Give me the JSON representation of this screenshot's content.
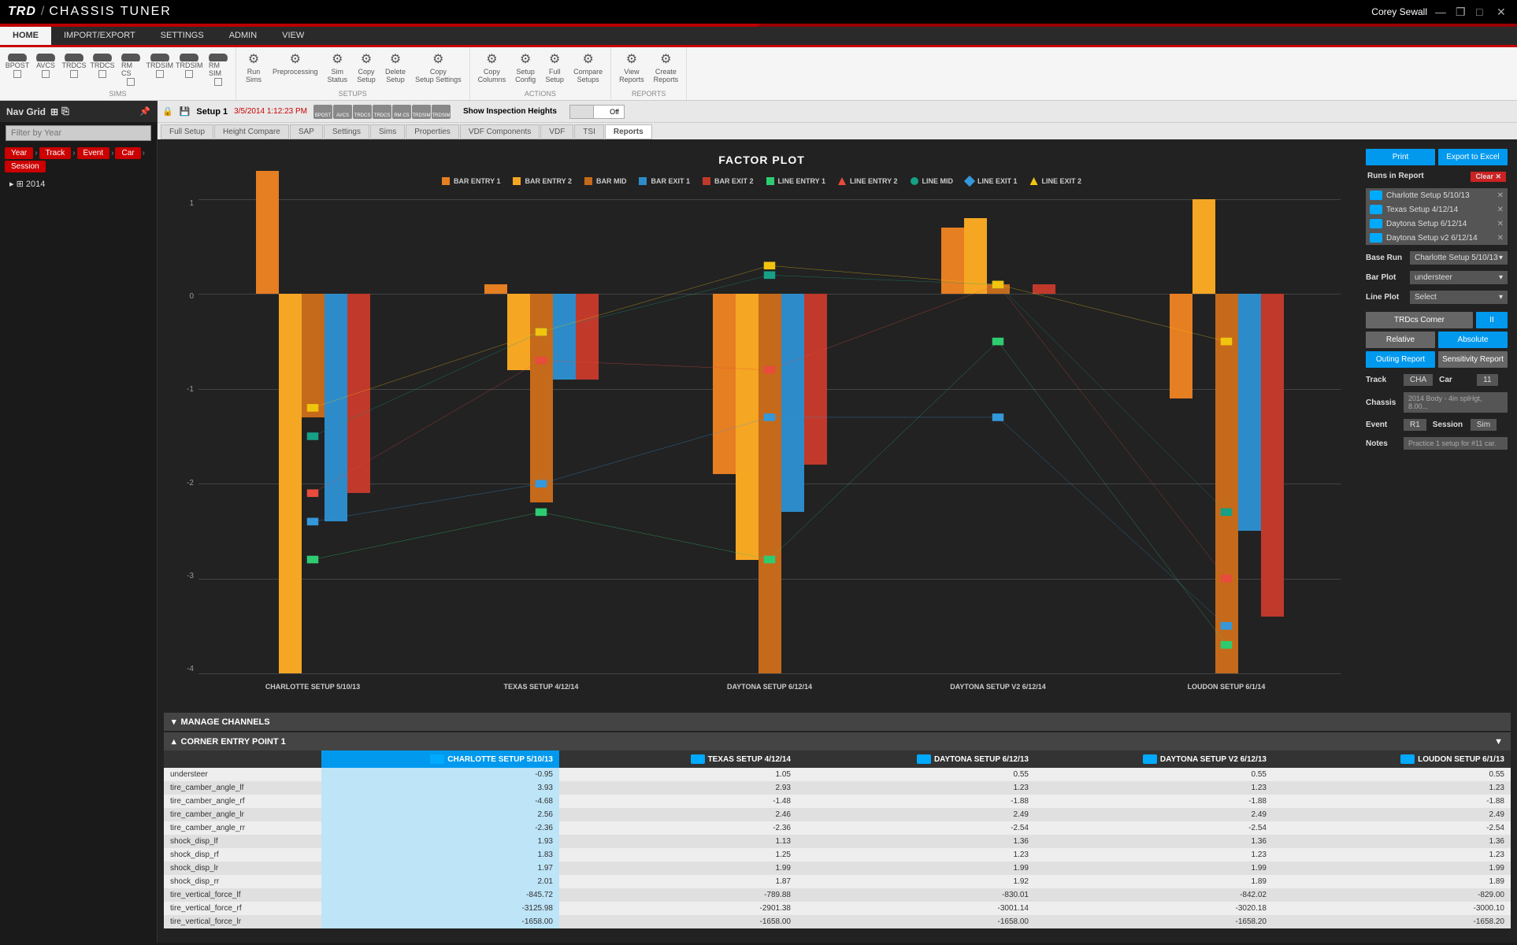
{
  "app": {
    "logo": "TRD",
    "sep": "/",
    "title": "CHASSIS TUNER",
    "user": "Corey Sewall"
  },
  "menu": [
    "HOME",
    "IMPORT/EXPORT",
    "SETTINGS",
    "ADMIN",
    "VIEW"
  ],
  "ribbon": {
    "sims": {
      "label": "SIMS",
      "items": [
        "BPOST",
        "AVCS",
        "TRDCS",
        "TRDCS",
        "RM CS",
        "TRDSIM",
        "TRDSIM",
        "RM SIM"
      ]
    },
    "actions_btns": [
      {
        "l1": "Run",
        "l2": "Sims"
      },
      {
        "l1": "Preprocessing",
        "l2": ""
      },
      {
        "l1": "Sim",
        "l2": "Status"
      },
      {
        "l1": "Copy",
        "l2": "Setup"
      },
      {
        "l1": "Delete",
        "l2": "Setup"
      },
      {
        "l1": "Copy",
        "l2": "Setup Settings"
      }
    ],
    "setups_label": "SETUPS",
    "actions2": [
      {
        "l1": "Copy",
        "l2": "Columns"
      },
      {
        "l1": "Setup",
        "l2": "Config"
      },
      {
        "l1": "Full",
        "l2": "Setup"
      },
      {
        "l1": "Compare",
        "l2": "Setups"
      }
    ],
    "actions_label": "ACTIONS",
    "reports": [
      {
        "l1": "View",
        "l2": "Reports"
      },
      {
        "l1": "Create",
        "l2": "Reports"
      }
    ],
    "reports_label": "REPORTS"
  },
  "sidebar": {
    "title": "Nav Grid",
    "filter_placeholder": "Filter by Year",
    "crumbs": [
      "Year",
      "Track",
      "Event",
      "Car",
      "Session"
    ],
    "tree": [
      "2014"
    ]
  },
  "setupbar": {
    "name": "Setup 1",
    "date": "3/5/2014 1:12:23 PM",
    "mini": [
      "BPOST",
      "AVCS",
      "TRDCS",
      "TRDCS",
      "RM CS",
      "TRDSIM",
      "TRDSIM"
    ],
    "insp": "Show Inspection Heights",
    "off": "Off"
  },
  "tabs": [
    "Full Setup",
    "Height Compare",
    "SAP",
    "Settings",
    "Sims",
    "Properties",
    "VDF Components",
    "VDF",
    "TSI",
    "Reports"
  ],
  "chart_data": {
    "type": "bar",
    "title": "FACTOR PLOT",
    "categories": [
      "CHARLOTTE SETUP 5/10/13",
      "TEXAS SETUP 4/12/14",
      "DAYTONA SETUP 6/12/14",
      "DAYTONA SETUP V2 6/12/14",
      "LOUDON SETUP 6/1/14"
    ],
    "ylim": [
      -4,
      1
    ],
    "yticks": [
      1,
      0,
      -1,
      -2,
      -3,
      -4
    ],
    "bar_series": [
      {
        "name": "BAR ENTRY 1",
        "color": "#e67e22",
        "values": [
          1.3,
          0.1,
          -1.9,
          0.7,
          -1.1
        ]
      },
      {
        "name": "BAR ENTRY 2",
        "color": "#f5a623",
        "values": [
          -4.0,
          -0.8,
          -2.8,
          0.8,
          1.0
        ]
      },
      {
        "name": "BAR MID",
        "color": "#c56a1a",
        "values": [
          -1.3,
          -2.2,
          -4.0,
          0.1,
          -4.0
        ]
      },
      {
        "name": "BAR EXIT 1",
        "color": "#2d8bc9",
        "values": [
          -2.4,
          -0.9,
          -2.3,
          0.0,
          -2.5
        ]
      },
      {
        "name": "BAR EXIT 2",
        "color": "#c0392b",
        "values": [
          -2.1,
          -0.9,
          -1.8,
          0.1,
          -3.4
        ]
      }
    ],
    "line_series": [
      {
        "name": "LINE ENTRY 1",
        "color": "#2ecc71",
        "shape": "sq",
        "values": [
          -2.8,
          -2.3,
          -2.8,
          -0.5,
          -3.7
        ]
      },
      {
        "name": "LINE ENTRY 2",
        "color": "#e74c3c",
        "shape": "tri",
        "values": [
          -2.1,
          -0.7,
          -0.8,
          0.1,
          -3.0
        ]
      },
      {
        "name": "LINE MID",
        "color": "#16a085",
        "shape": "circ",
        "values": [
          -1.5,
          -0.4,
          0.2,
          0.1,
          -2.3
        ]
      },
      {
        "name": "LINE EXIT 1",
        "color": "#3498db",
        "shape": "dia",
        "values": [
          -2.4,
          -2.0,
          -1.3,
          -1.3,
          -3.5
        ]
      },
      {
        "name": "LINE EXIT 2",
        "color": "#f1c40f",
        "shape": "tri",
        "values": [
          -1.2,
          -0.4,
          0.3,
          0.1,
          -0.5
        ]
      }
    ]
  },
  "controls": {
    "print": "Print",
    "export": "Export to Excel",
    "runs_hdr": "Runs in Report",
    "clear": "Clear",
    "runs": [
      "Charlotte Setup 5/10/13",
      "Texas Setup 4/12/14",
      "Daytona Setup 6/12/14",
      "Daytona Setup v2 6/12/14"
    ],
    "base_run_lbl": "Base Run",
    "base_run": "Charlotte Setup 5/10/13",
    "bar_plot_lbl": "Bar Plot",
    "bar_plot": "understeer",
    "line_plot_lbl": "Line Plot",
    "line_plot": "Select",
    "trd": "TRDcs Corner",
    "ii": "II",
    "relative": "Relative",
    "absolute": "Absolute",
    "outing": "Outing Report",
    "sensitivity": "Sensitivity Report",
    "track_lbl": "Track",
    "track": "CHA",
    "car_lbl": "Car",
    "car": "11",
    "chassis_lbl": "Chassis",
    "chassis": "2014 Body - 4in splHgt, 8.00...",
    "event_lbl": "Event",
    "event": "R1",
    "session_lbl": "Session",
    "session": "Sim",
    "notes_lbl": "Notes",
    "notes": "Practice 1 setup for #11 car."
  },
  "table": {
    "manage": "MANAGE CHANNELS",
    "section": "CORNER ENTRY POINT 1",
    "headers": [
      "",
      "CHARLOTTE SETUP 5/10/13",
      "TEXAS SETUP 4/12/14",
      "DAYTONA SETUP 6/12/13",
      "DAYTONA SETUP V2 6/12/13",
      "LOUDON SETUP 6/1/13"
    ],
    "rows": [
      {
        "n": "understeer",
        "v": [
          "-0.95",
          "1.05",
          "0.55",
          "0.55",
          "0.55"
        ]
      },
      {
        "n": "tire_camber_angle_lf",
        "v": [
          "3.93",
          "2.93",
          "1.23",
          "1.23",
          "1.23"
        ]
      },
      {
        "n": "tire_camber_angle_rf",
        "v": [
          "-4.68",
          "-1.48",
          "-1.88",
          "-1.88",
          "-1.88"
        ]
      },
      {
        "n": "tire_camber_angle_lr",
        "v": [
          "2.56",
          "2.46",
          "2.49",
          "2.49",
          "2.49"
        ]
      },
      {
        "n": "tire_camber_angle_rr",
        "v": [
          "-2.36",
          "-2.36",
          "-2.54",
          "-2.54",
          "-2.54"
        ]
      },
      {
        "n": "shock_disp_lf",
        "v": [
          "1.93",
          "1.13",
          "1.36",
          "1.36",
          "1.36"
        ]
      },
      {
        "n": "shock_disp_rf",
        "v": [
          "1.83",
          "1.25",
          "1.23",
          "1.23",
          "1.23"
        ]
      },
      {
        "n": "shock_disp_lr",
        "v": [
          "1.97",
          "1.99",
          "1.99",
          "1.99",
          "1.99"
        ]
      },
      {
        "n": "shock_disp_rr",
        "v": [
          "2.01",
          "1.87",
          "1.92",
          "1.89",
          "1.89"
        ]
      },
      {
        "n": "tire_vertical_force_lf",
        "v": [
          "-845.72",
          "-789.88",
          "-830.01",
          "-842.02",
          "-829.00"
        ]
      },
      {
        "n": "tire_vertical_force_rf",
        "v": [
          "-3125.98",
          "-2901.38",
          "-3001.14",
          "-3020.18",
          "-3000.10"
        ]
      },
      {
        "n": "tire_vertical_force_lr",
        "v": [
          "-1658.00",
          "-1658.00",
          "-1658.00",
          "-1658.20",
          "-1658.20"
        ]
      }
    ]
  }
}
